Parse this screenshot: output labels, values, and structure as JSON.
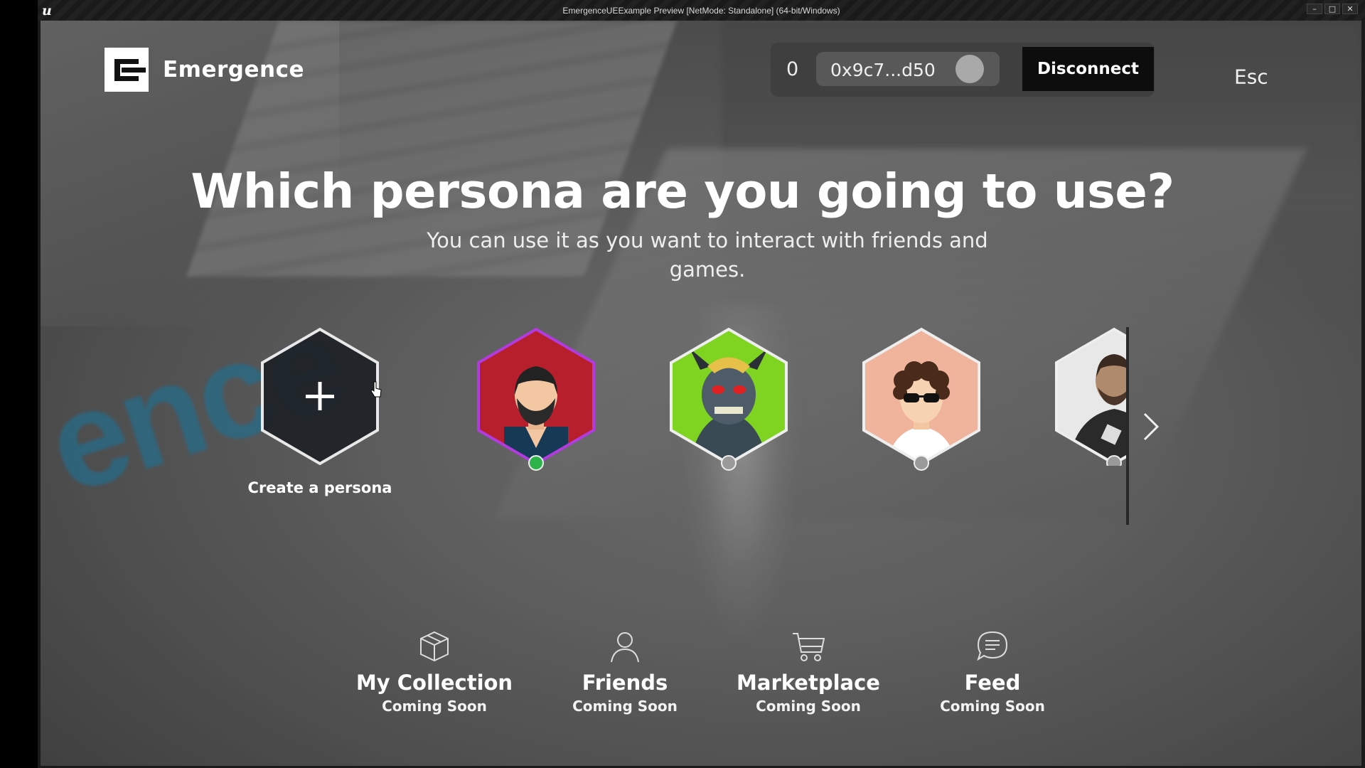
{
  "window": {
    "title": "EmergenceUEExample Preview [NetMode: Standalone]  (64-bit/Windows)",
    "app_icon": "unreal-engine-logo",
    "controls": [
      "minimize",
      "maximize",
      "close"
    ]
  },
  "header": {
    "brand_name": "Emergence",
    "wallet": {
      "balance": "0",
      "address": "0x9c7...d50",
      "disconnect_label": "Disconnect"
    },
    "esc_label": "Esc"
  },
  "main": {
    "headline": "Which persona are you going to use?",
    "subtitle": "You can use it as you want to interact with friends and games.",
    "create_persona_label": "Create a persona",
    "personas": [
      {
        "avatar": "bearded-man-avatar",
        "active": true
      },
      {
        "avatar": "green-goblin-creature-avatar",
        "active": false
      },
      {
        "avatar": "curly-hair-sunglasses-avatar",
        "active": false
      },
      {
        "avatar": "armored-man-avatar",
        "active": false
      }
    ]
  },
  "bottom_nav": [
    {
      "icon": "box-icon",
      "title": "My Collection",
      "status": "Coming Soon"
    },
    {
      "icon": "person-icon",
      "title": "Friends",
      "status": "Coming Soon"
    },
    {
      "icon": "cart-icon",
      "title": "Marketplace",
      "status": "Coming Soon"
    },
    {
      "icon": "chat-bubble-icon",
      "title": "Feed",
      "status": "Coming Soon"
    }
  ],
  "colors": {
    "active_indicator": "#2db34a",
    "inactive_indicator": "#9a9a9a",
    "active_persona_border": "#b23be0",
    "disconnect_bg": "#0d0d0d"
  }
}
